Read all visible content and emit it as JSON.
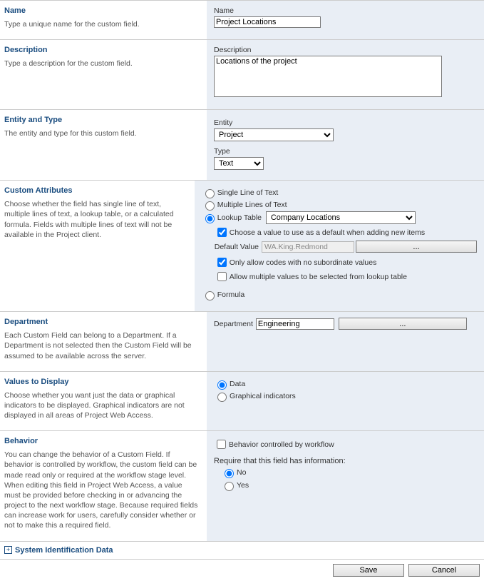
{
  "section_name": {
    "heading": "Name",
    "desc": "Type a unique name for the custom field.",
    "label": "Name",
    "value": "Project Locations"
  },
  "section_description": {
    "heading": "Description",
    "desc": "Type a description for the custom field.",
    "label": "Description",
    "value": "Locations of the project"
  },
  "section_entity_type": {
    "heading": "Entity and Type",
    "desc": "The entity and type for this custom field.",
    "entity_label": "Entity",
    "entity_value": "Project",
    "type_label": "Type",
    "type_value": "Text"
  },
  "section_custom_attributes": {
    "heading": "Custom Attributes",
    "desc": "Choose whether the field has single line of text, multiple lines of text, a lookup table, or a calculated formula. Fields with multiple lines of text will not be available in the Project client.",
    "radio_single": "Single Line of Text",
    "radio_multi": "Multiple Lines of Text",
    "radio_lookup": "Lookup Table",
    "lookup_value": "Company Locations",
    "check_default": "Choose a value to use as a default when adding new items",
    "default_label": "Default Value",
    "default_value": "WA.King.Redmond",
    "ellipsis": "...",
    "check_only_codes": "Only allow codes with no subordinate values",
    "check_allow_multi": "Allow multiple values to be selected from lookup table",
    "radio_formula": "Formula"
  },
  "section_department": {
    "heading": "Department",
    "desc": "Each Custom Field can belong to a Department. If a Department is not selected then the Custom Field will be assumed to be available across the server.",
    "label": "Department",
    "value": "Engineering",
    "ellipsis": "..."
  },
  "section_values_to_display": {
    "heading": "Values to Display",
    "desc": "Choose whether you want just the data or graphical indicators to be displayed.\nGraphical indicators are not displayed in all areas of Project Web Access.",
    "radio_data": "Data",
    "radio_graphical": "Graphical indicators"
  },
  "section_behavior": {
    "heading": "Behavior",
    "desc": "You can change the behavior of a Custom Field.  If behavior is controlled by workflow, the custom field can be made read only or required at the workflow stage level.  When editing this field in Project Web Access, a value must be provided before checking in or advancing the project to the next workflow stage.  Because required fields can increase work for users, carefully consider whether or not to make this a required field.",
    "check_workflow": "Behavior controlled by workflow",
    "require_label": "Require that this field has information:",
    "radio_no": "No",
    "radio_yes": "Yes"
  },
  "sysdata": {
    "icon": "+",
    "label": "System Identification Data"
  },
  "footer": {
    "save": "Save",
    "cancel": "Cancel"
  }
}
